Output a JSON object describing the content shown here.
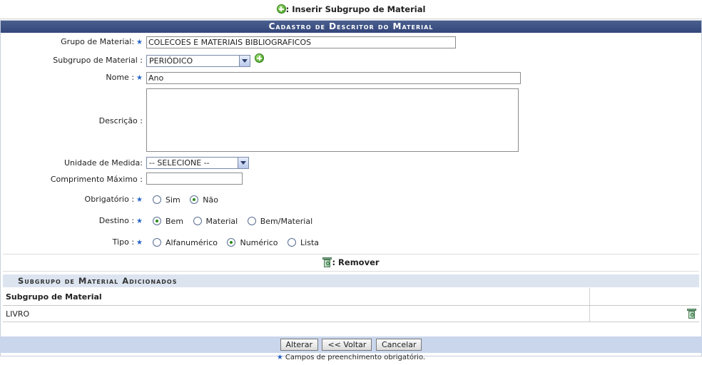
{
  "header": {
    "title": ": Inserir Subgrupo de Material"
  },
  "form": {
    "title": "Cadastro de Descritor do Material",
    "grupo_label": "Grupo de Material:",
    "grupo_value": "COLECOES E MATERIAIS BIBLIOGRAFICOS",
    "subgrupo_label": "Subgrupo de Material :",
    "subgrupo_value": "PERIÓDICO",
    "nome_label": "Nome :",
    "nome_value": "Ano",
    "descricao_label": "Descrição :",
    "descricao_value": "",
    "unidade_label": "Unidade de Medida:",
    "unidade_value": "-- SELECIONE --",
    "comprimento_label": "Comprimento Máximo :",
    "comprimento_value": "",
    "obrigatorio_label": "Obrigatório :",
    "obrigatorio_options": [
      "Sim",
      "Não"
    ],
    "obrigatorio_selected": "Não",
    "destino_label": "Destino :",
    "destino_options": [
      "Bem",
      "Material",
      "Bem/Material"
    ],
    "destino_selected": "Bem",
    "tipo_label": "Tipo :",
    "tipo_options": [
      "Alfanumérico",
      "Numérico",
      "Lista"
    ],
    "tipo_selected": "Numérico"
  },
  "remover": {
    "label": ": Remover"
  },
  "subgrupos": {
    "title": "Subgrupo de Material Adicionados",
    "column": "Subgrupo de Material",
    "rows": [
      {
        "name": "LIVRO"
      }
    ]
  },
  "buttons": {
    "alterar": "Alterar",
    "voltar": "<< Voltar",
    "cancelar": "Cancelar"
  },
  "note": "Campos de preenchimento obrigatório.",
  "colors": {
    "accent": "#33467a",
    "footer": "#c9d6ec",
    "required_star": "#2563c9"
  }
}
